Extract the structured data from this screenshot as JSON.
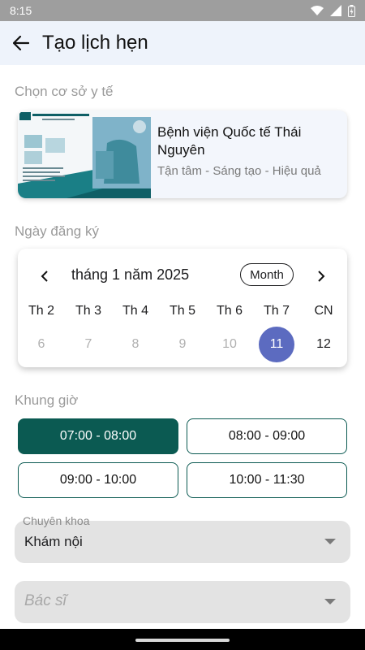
{
  "status_bar": {
    "time": "8:15",
    "icons": [
      "wifi-icon",
      "signal-icon",
      "battery-icon"
    ]
  },
  "app_bar": {
    "title": "Tạo lịch hẹn",
    "back_icon": "arrow-left-icon"
  },
  "facility": {
    "section_label": "Chọn cơ sở y tế",
    "name": "Bệnh viện Quốc tế Thái Nguyên",
    "slogan": "Tận tâm - Sáng tạo - Hiệu quả",
    "image_caption": "CÔNG TY CỔ PHẦN TẬP ĐOÀN BỆNH VIỆN TNH",
    "image_hotline": "Hotline: 1900 8613"
  },
  "calendar": {
    "section_label": "Ngày đăng ký",
    "month_label": "tháng 1 năm 2025",
    "view_button": "Month",
    "weekdays": [
      "Th 2",
      "Th 3",
      "Th 4",
      "Th 5",
      "Th 6",
      "Th 7",
      "CN"
    ],
    "days": [
      "6",
      "7",
      "8",
      "9",
      "10",
      "11",
      "12"
    ],
    "selected_day": "11"
  },
  "time_slots": {
    "section_label": "Khung giờ",
    "slots": [
      "07:00 - 08:00",
      "08:00 - 09:00",
      "09:00 - 10:00",
      "10:00 - 11:30"
    ],
    "active_slot": "07:00 - 08:00"
  },
  "specialty": {
    "label": "Chuyên khoa",
    "value": "Khám nội"
  },
  "doctor": {
    "placeholder": "Bác sĩ"
  },
  "colors": {
    "primary": "#0b5a52",
    "selected_day": "#5c6bc0",
    "app_bar_bg": "#eef3fb",
    "dropdown_bg": "#e3e3e3"
  }
}
